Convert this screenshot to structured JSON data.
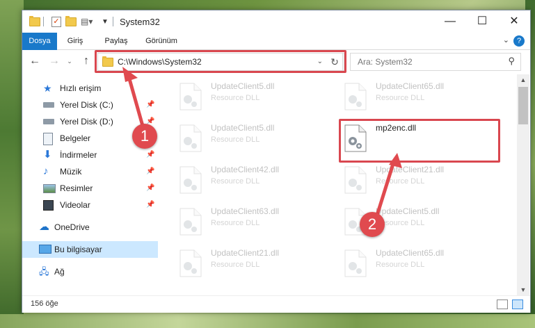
{
  "window": {
    "title": "System32",
    "controls": {
      "minimize": "—",
      "maximize": "☐",
      "close": "✕"
    }
  },
  "ribbon": {
    "tabs": [
      "Dosya",
      "Giriş",
      "Paylaş",
      "Görünüm"
    ],
    "help": "?"
  },
  "address": {
    "path": "C:\\Windows\\System32",
    "search_placeholder": "Ara: System32"
  },
  "sidebar": {
    "items": [
      {
        "label": "Hızlı erişim",
        "icon": "star-icon"
      },
      {
        "label": "Yerel Disk (C:)",
        "icon": "drive-icon",
        "pinned": true
      },
      {
        "label": "Yerel Disk (D:)",
        "icon": "drive-icon",
        "pinned": true
      },
      {
        "label": "Belgeler",
        "icon": "document-icon",
        "pinned": true
      },
      {
        "label": "İndirmeler",
        "icon": "download-icon",
        "pinned": true
      },
      {
        "label": "Müzik",
        "icon": "music-icon",
        "pinned": true
      },
      {
        "label": "Resimler",
        "icon": "pictures-icon",
        "pinned": true
      },
      {
        "label": "Videolar",
        "icon": "video-icon",
        "pinned": true
      },
      {
        "label": "OneDrive",
        "icon": "cloud-icon"
      },
      {
        "label": "Bu bilgisayar",
        "icon": "computer-icon",
        "selected": true
      },
      {
        "label": "Ağ",
        "icon": "network-icon"
      }
    ]
  },
  "files": [
    {
      "name": "UpdateClient5.dll",
      "desc": "Resource DLL"
    },
    {
      "name": "UpdateClient65.dll",
      "desc": "Resource DLL"
    },
    {
      "name": "UpdateClient5.dll",
      "desc": "Resource DLL"
    },
    {
      "name": "mp2enc.dll",
      "desc": ""
    },
    {
      "name": "UpdateClient42.dll",
      "desc": "Resource DLL"
    },
    {
      "name": "UpdateClient21.dll",
      "desc": "Resource DLL"
    },
    {
      "name": "UpdateClient63.dll",
      "desc": "Resource DLL"
    },
    {
      "name": "UpdateClient5.dll",
      "desc": "Resource DLL"
    },
    {
      "name": "UpdateClient21.dll",
      "desc": "Resource DLL"
    },
    {
      "name": "UpdateClient65.dll",
      "desc": "Resource DLL"
    }
  ],
  "status": {
    "count": "156 öğe"
  },
  "annotations": {
    "step1": "1",
    "step2": "2",
    "color": "#e04a4f"
  }
}
